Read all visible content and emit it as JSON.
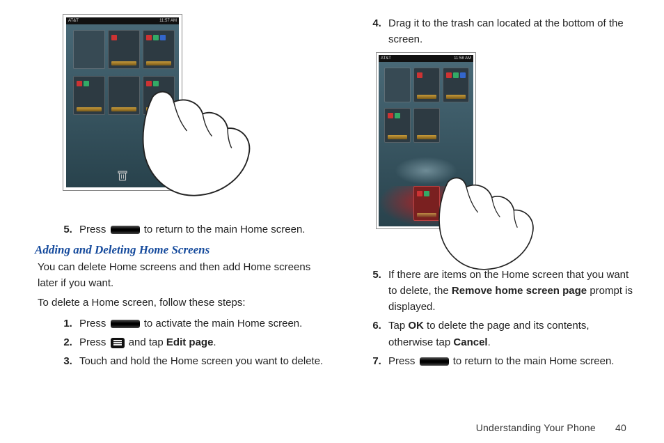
{
  "left": {
    "statusbar": {
      "carrier": "AT&T",
      "time": "11:57 AM"
    },
    "step5_a": "Press",
    "step5_b": "to return to the main Home screen.",
    "subhead": "Adding and Deleting Home Screens",
    "intro": "You can delete Home screens and then add Home screens later if you want.",
    "lead": "To delete a Home screen, follow these steps:",
    "s1a": "Press",
    "s1b": "to activate the main Home screen.",
    "s2a": "Press",
    "s2b": "and tap",
    "s2_bold": "Edit page",
    "s2c": ".",
    "s3": "Touch and hold the Home screen you want to delete."
  },
  "right": {
    "statusbar": {
      "carrier": "AT&T",
      "time": "11:58 AM"
    },
    "s4": "Drag it to the trash can located at the bottom of the screen.",
    "s5a": "If there are items on the Home screen that you want to delete, the",
    "s5_bold": "Remove home screen page",
    "s5b": "prompt is displayed.",
    "s6a": "Tap",
    "s6_ok": "OK",
    "s6b": "to delete the page and its contents, otherwise tap",
    "s6_cancel": "Cancel",
    "s6c": ".",
    "s7a": "Press",
    "s7b": "to return to the main Home screen."
  },
  "footer": {
    "section": "Understanding Your Phone",
    "page": "40"
  }
}
